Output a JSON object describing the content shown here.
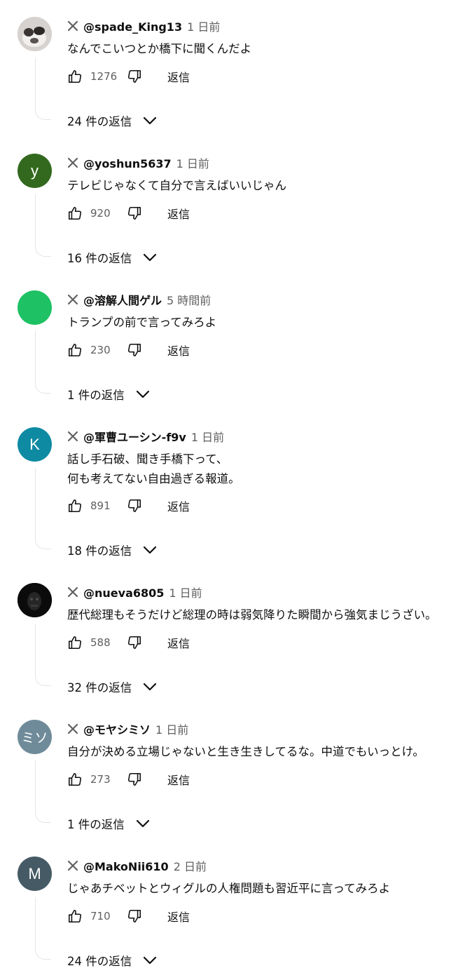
{
  "reply_label": "返信",
  "comments": [
    {
      "author": "@spade_King13",
      "time": "1 日前",
      "text": "なんでこいつとか橋下に聞くんだよ",
      "likes": "1276",
      "replies": "24 件の返信",
      "avatar": {
        "type": "photo",
        "bg": "#c9c5c2"
      }
    },
    {
      "author": "@yoshun5637",
      "time": "1 日前",
      "text": "テレビじゃなくて自分で言えばいいじゃん",
      "likes": "920",
      "replies": "16 件の返信",
      "avatar": {
        "type": "letter",
        "letter": "y",
        "bg": "#33691e"
      }
    },
    {
      "author": "@溶解人間ゲル",
      "time": "5 時間前",
      "text": "トランプの前で言ってみろよ",
      "likes": "230",
      "replies": "1 件の返信",
      "avatar": {
        "type": "solid",
        "bg": "#1ec163"
      }
    },
    {
      "author": "@軍曹ユーシン-f9v",
      "time": "1 日前",
      "text": "話し手石破、聞き手橋下って、",
      "text2": "何も考えてない自由過ぎる報道。",
      "likes": "891",
      "replies": "18 件の返信",
      "avatar": {
        "type": "letter",
        "letter": "K",
        "bg": "#0f8aa3"
      }
    },
    {
      "author": "@nueva6805",
      "time": "1 日前",
      "text": "歴代総理もそうだけど総理の時は弱気降りた瞬間から強気まじうざい。",
      "likes": "588",
      "replies": "32 件の返信",
      "avatar": {
        "type": "photo-dark",
        "bg": "#0a0a0a"
      }
    },
    {
      "author": "@モヤシミソ",
      "time": "1 日前",
      "text": "自分が決める立場じゃないと生き生きしてるな。中道でもいっとけ。",
      "likes": "273",
      "replies": "1 件の返信",
      "avatar": {
        "type": "letter",
        "letter": "ミソ",
        "bg": "#6f8b9a"
      }
    },
    {
      "author": "@MakoNii610",
      "time": "2 日前",
      "text": "じゃあチベットとウィグルの人権問題も習近平に言ってみろよ",
      "likes": "710",
      "replies": "24 件の返信",
      "avatar": {
        "type": "letter",
        "letter": "M",
        "bg": "#455a64"
      }
    }
  ]
}
